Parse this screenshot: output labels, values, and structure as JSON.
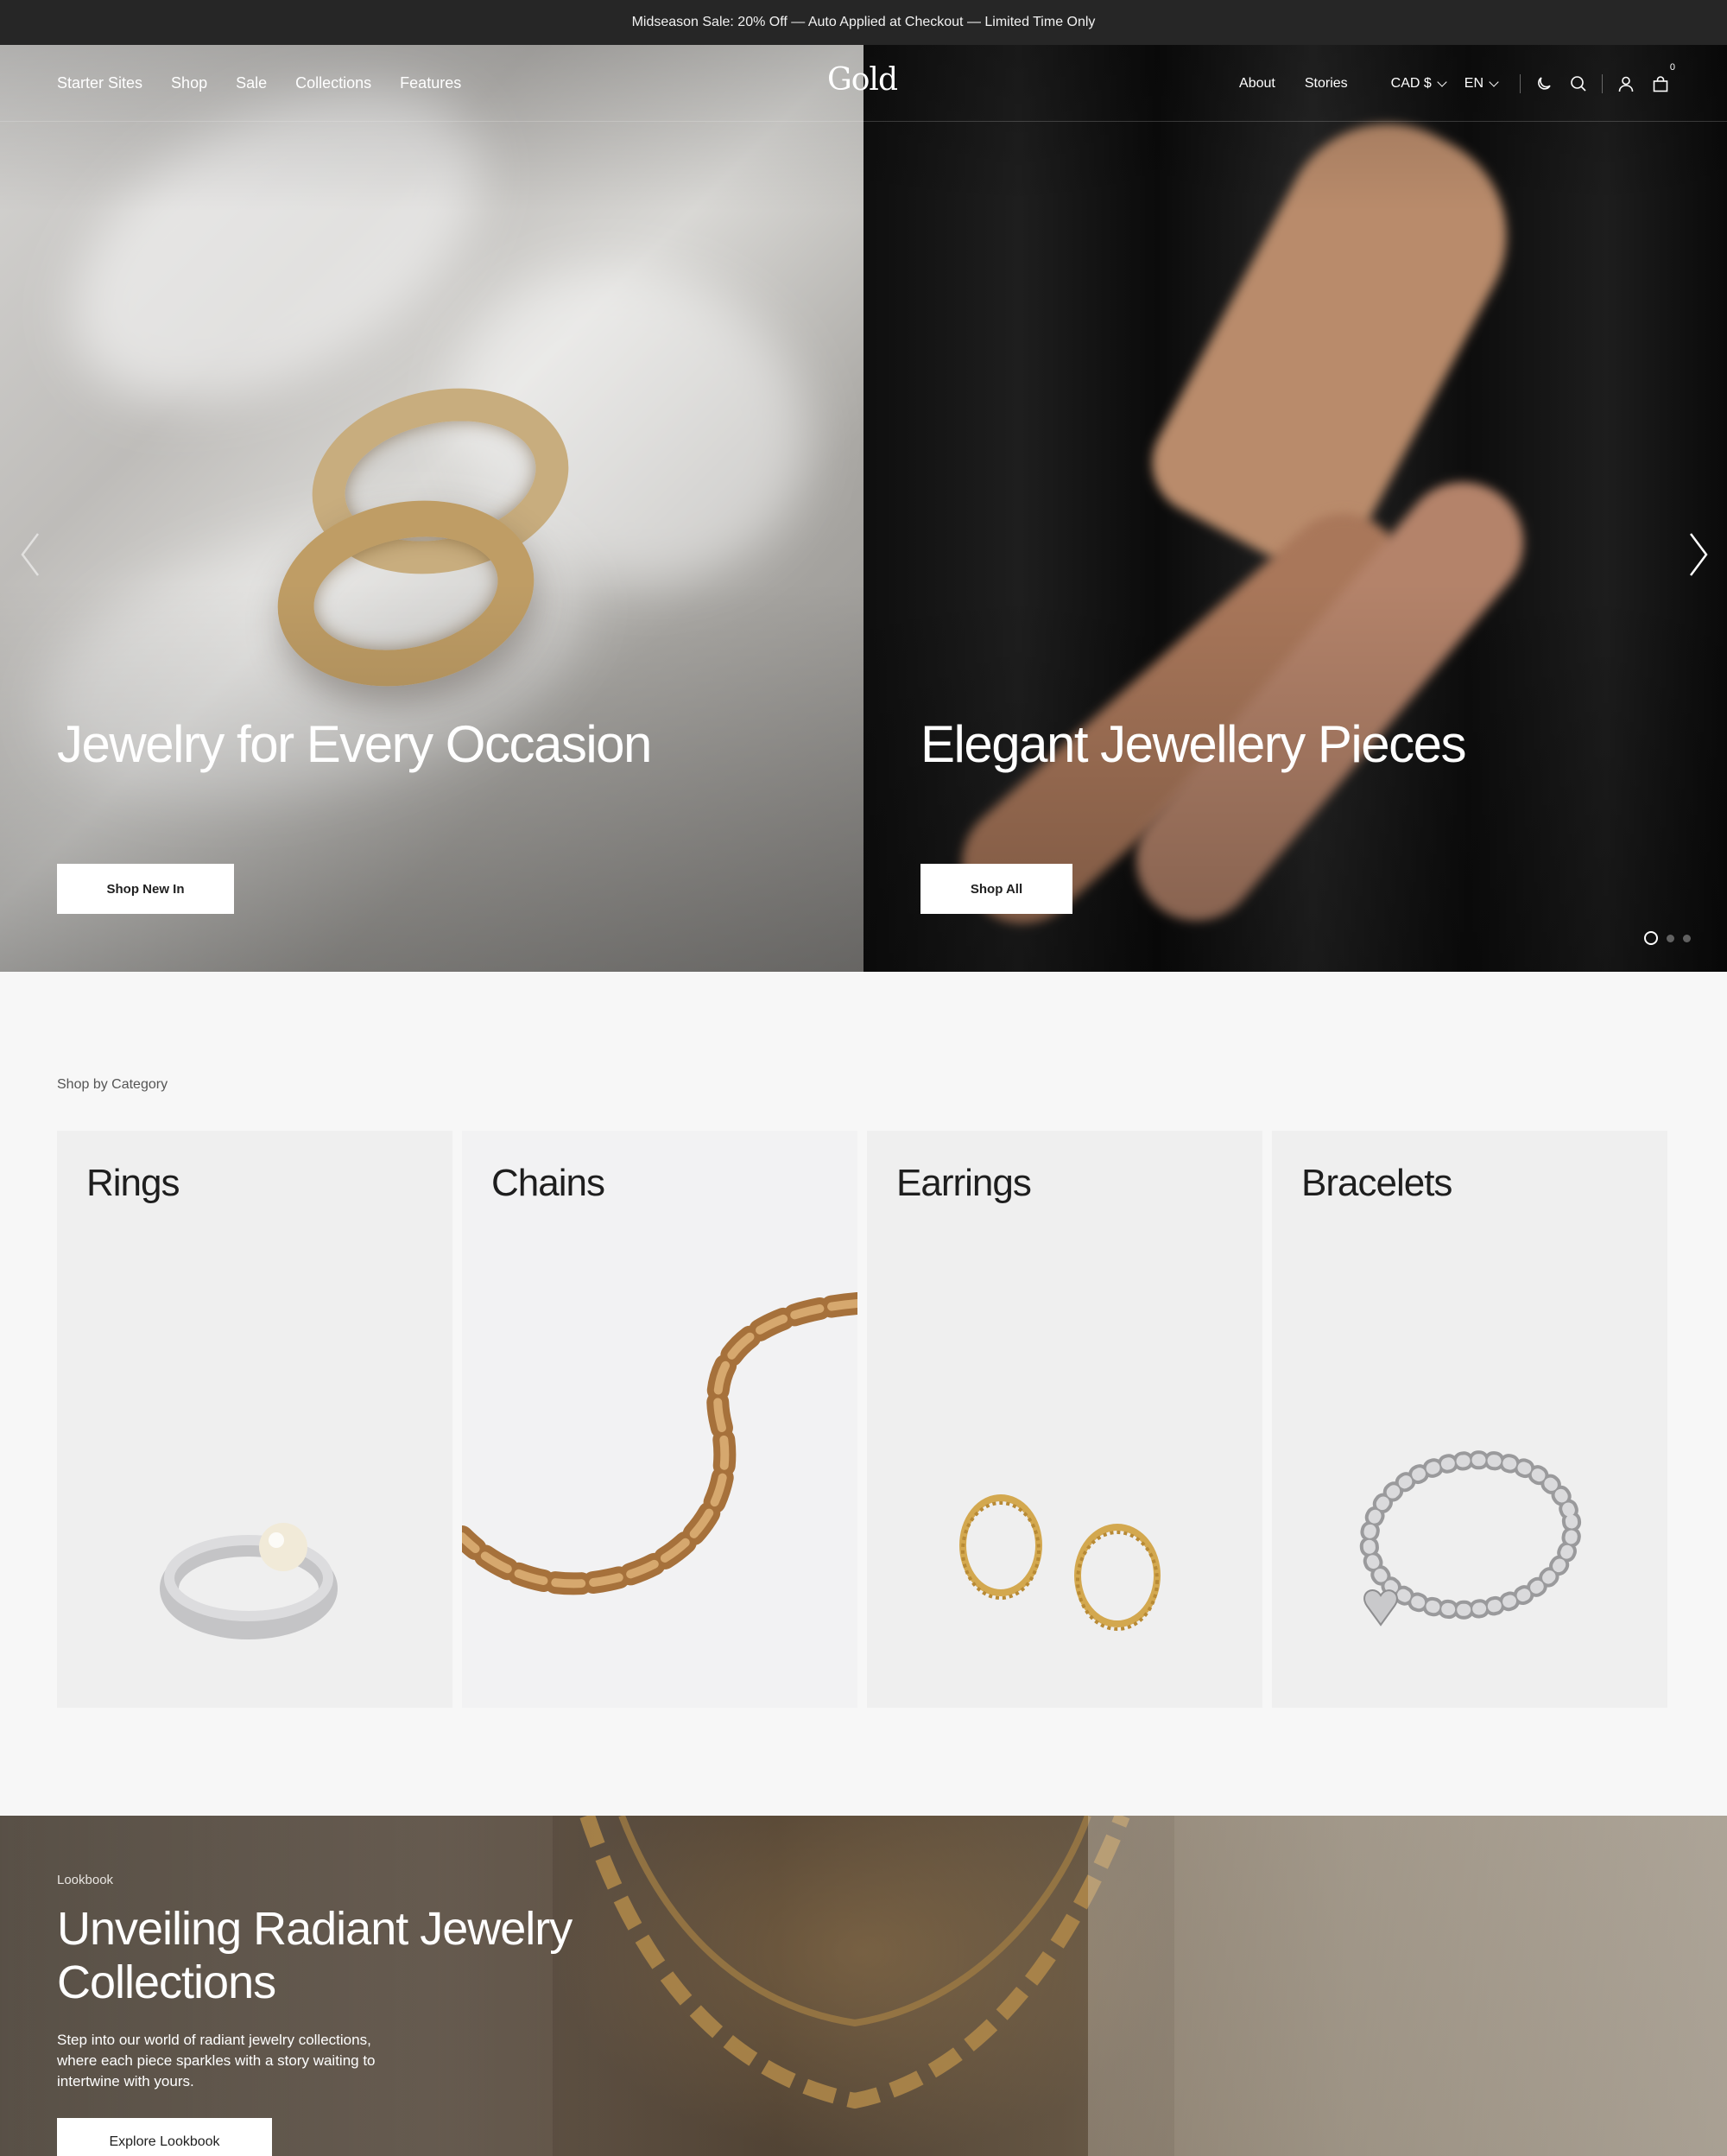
{
  "announcement": {
    "text": "Midseason Sale: 20% Off — Auto Applied at Checkout — Limited Time Only"
  },
  "header": {
    "logo": "Gold",
    "nav_left": [
      "Starter Sites",
      "Shop",
      "Sale",
      "Collections",
      "Features"
    ],
    "nav_right": [
      "About",
      "Stories"
    ],
    "currency": "CAD $",
    "language": "EN",
    "cart_count": "0",
    "icons": [
      "moon-icon",
      "search-icon",
      "user-icon",
      "bag-icon"
    ]
  },
  "hero": {
    "slides": [
      {
        "title": "Jewelry for Every Occasion",
        "button": "Shop New In"
      },
      {
        "title": "Elegant Jewellery Pieces",
        "button": "Shop All"
      }
    ],
    "pagination": {
      "total": 3,
      "active": 1
    }
  },
  "categories": {
    "label": "Shop by Category",
    "items": [
      "Rings",
      "Chains",
      "Earrings",
      "Bracelets"
    ]
  },
  "lookbook": {
    "tag": "Lookbook",
    "title": "Unveiling Radiant Jewelry Collections",
    "text": "Step into our world of radiant jewelry collections, where each piece sparkles with a story waiting to intertwine with yours.",
    "button": "Explore Lookbook"
  },
  "colors": {
    "announcement_bg": "#262626",
    "page_bg": "#f7f7f7",
    "card_bg": "#efefef",
    "button_bg": "#ffffff",
    "text_dark": "#1f1f1f"
  }
}
